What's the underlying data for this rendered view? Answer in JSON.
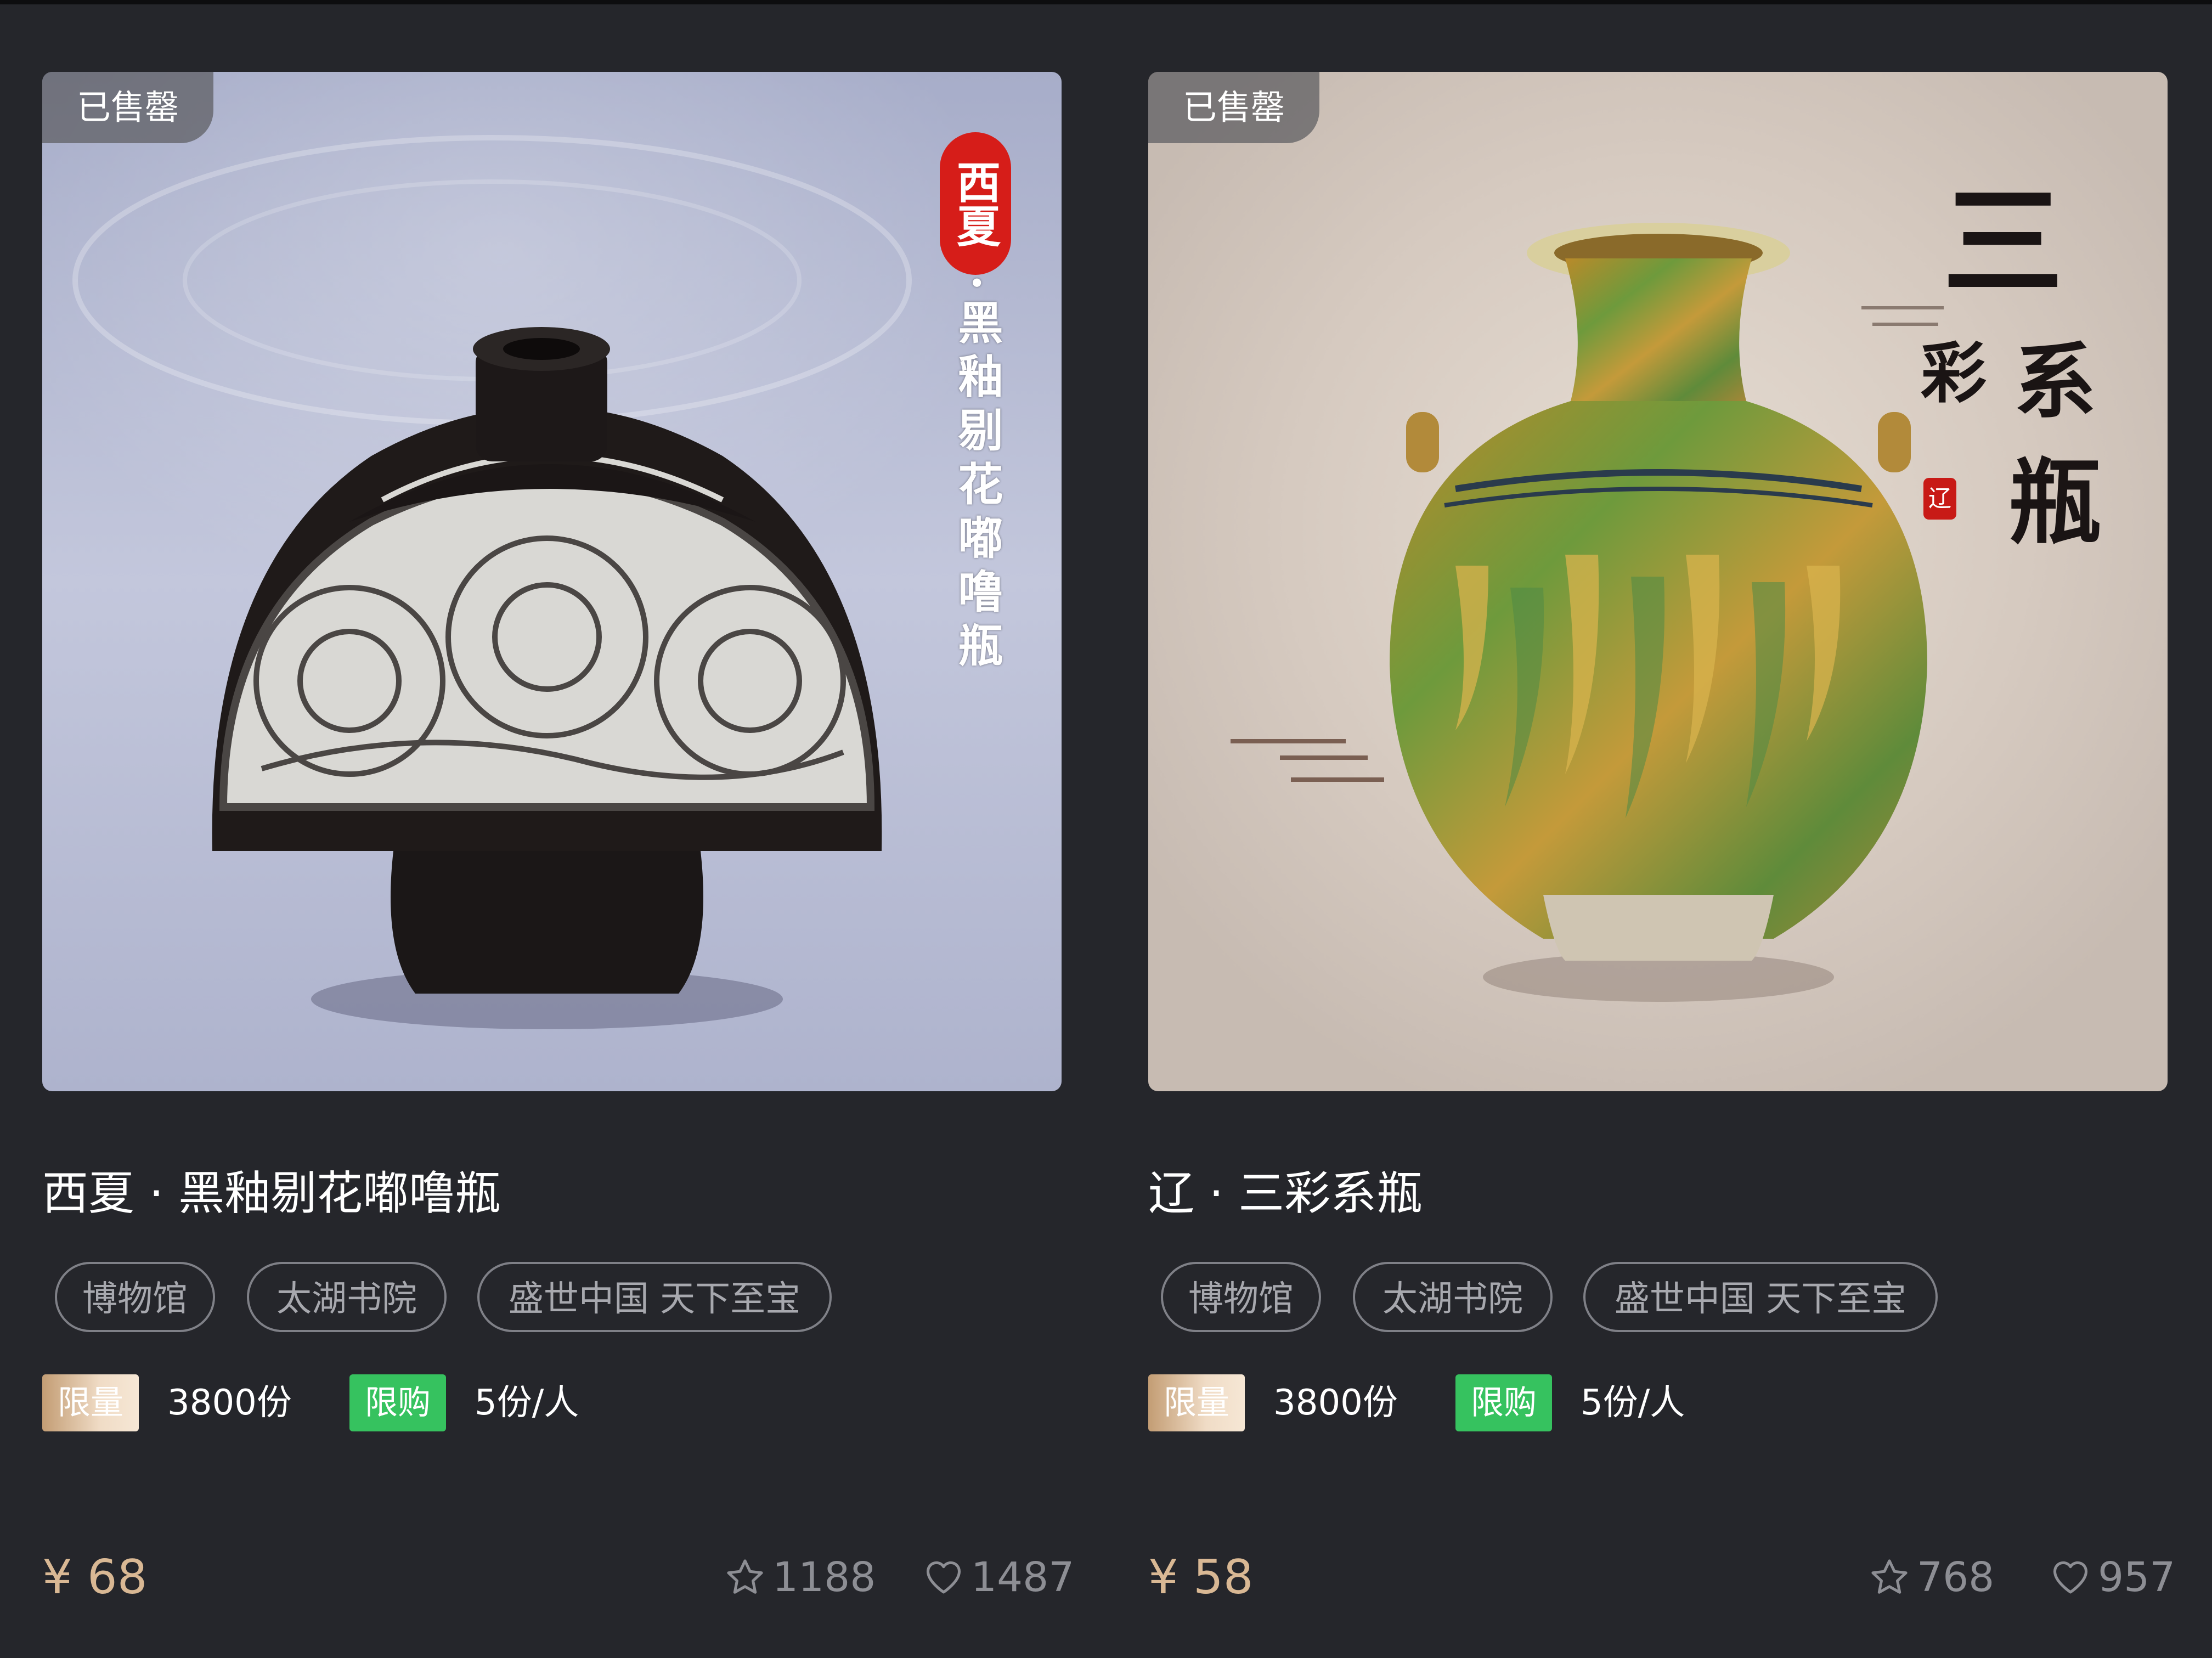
{
  "products": [
    {
      "sold_badge": "已售罄",
      "image_title_seal": "西夏",
      "image_title_vertical": "·黑釉剔花嘟噜瓶",
      "name": "西夏 · 黑釉剔花嘟噜瓶",
      "tags": [
        "博物馆",
        "太湖书院",
        "盛世中国 天下至宝"
      ],
      "limit_label": "限量",
      "limit_value": "3800份",
      "purchase_label": "限购",
      "purchase_value": "5份/人",
      "price": "¥ 68",
      "stars": "1188",
      "likes": "1487"
    },
    {
      "sold_badge": "已售罄",
      "image_title_chars": [
        "三",
        "彩",
        "系",
        "瓶"
      ],
      "image_seal": "辽",
      "name": "辽 · 三彩系瓶",
      "tags": [
        "博物馆",
        "太湖书院",
        "盛世中国 天下至宝"
      ],
      "limit_label": "限量",
      "limit_value": "3800份",
      "purchase_label": "限购",
      "purchase_value": "5份/人",
      "price": "¥ 58",
      "stars": "768",
      "likes": "957"
    }
  ],
  "colors": {
    "background": "#25262b",
    "price": "#d9b894",
    "limit_badge_gold": "#d7b896",
    "purchase_badge_green": "#36c25f",
    "tag_border": "#7f8087"
  },
  "icons": [
    "star-outline-icon",
    "heart-outline-icon"
  ]
}
